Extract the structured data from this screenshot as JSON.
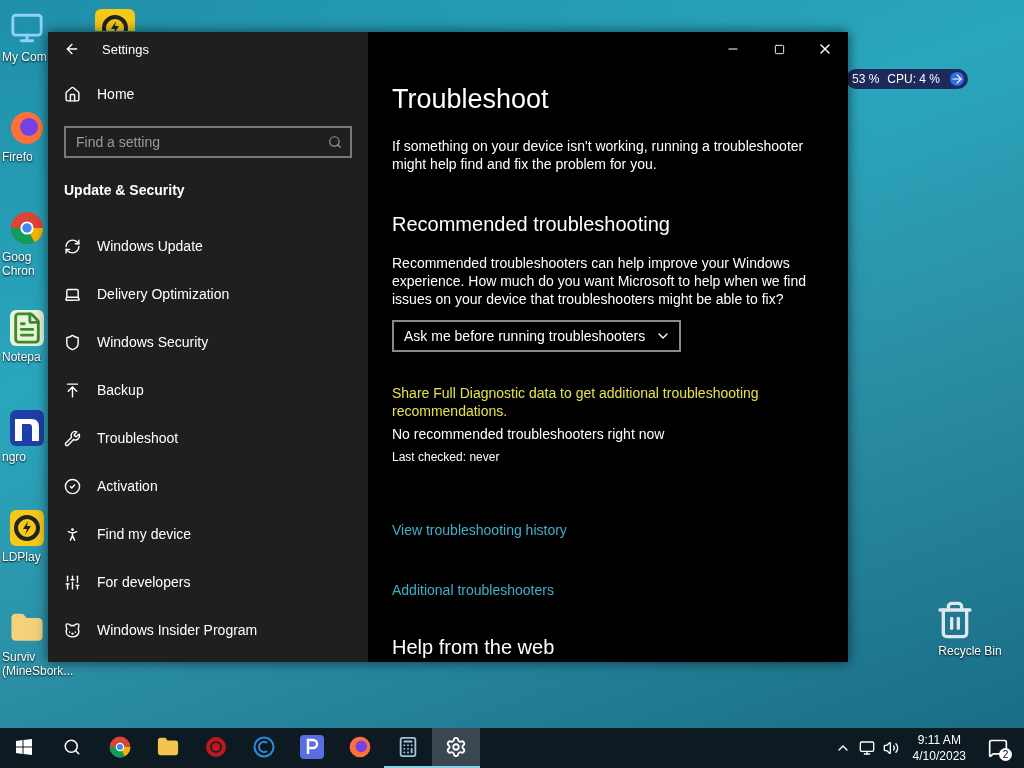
{
  "desktop_icons": [
    {
      "kind": "computer",
      "lines": [
        "My Com"
      ]
    },
    {
      "kind": "firefox",
      "lines": [
        "Firefo"
      ]
    },
    {
      "kind": "chrome",
      "lines": [
        "Goog",
        "Chron"
      ]
    },
    {
      "kind": "notepad",
      "lines": [
        "Notepa"
      ]
    },
    {
      "kind": "ngrok",
      "lines": [
        "ngro"
      ]
    },
    {
      "kind": "ldplayer",
      "lines": [
        "LDPlay"
      ]
    },
    {
      "kind": "folder",
      "lines": [
        "Surviv",
        "(MineSbork..."
      ]
    }
  ],
  "recycle_bin": {
    "label": "Recycle Bin"
  },
  "monitor_widget": {
    "memory": "53 %",
    "cpu": "CPU: 4 %"
  },
  "window": {
    "title": "Settings",
    "sidebar": {
      "home": "Home",
      "search": {
        "placeholder": "Find a setting"
      },
      "section": "Update & Security",
      "items": [
        {
          "kind": "update",
          "label": "Windows Update"
        },
        {
          "kind": "delivery",
          "label": "Delivery Optimization"
        },
        {
          "kind": "security",
          "label": "Windows Security"
        },
        {
          "kind": "backup",
          "label": "Backup"
        },
        {
          "kind": "troubleshoot",
          "label": "Troubleshoot"
        },
        {
          "kind": "activation",
          "label": "Activation"
        },
        {
          "kind": "find",
          "label": "Find my device"
        },
        {
          "kind": "developers",
          "label": "For developers"
        },
        {
          "kind": "insider",
          "label": "Windows Insider Program"
        }
      ]
    },
    "content": {
      "title": "Troubleshoot",
      "intro": "If something on your device isn't working, running a troubleshooter might help find and fix the problem for you.",
      "section": "Recommended troubleshooting",
      "description": "Recommended troubleshooters can help improve your Windows experience. How much do you want Microsoft to help when we find issues on your device that troubleshooters might be able to fix?",
      "dropdown": "Ask me before running troubleshooters",
      "diagnostic_link": "Share Full Diagnostic data to get additional troubleshooting recommendations.",
      "status": "No recommended troubleshooters right now",
      "last_checked": "Last checked: never",
      "links": [
        "View troubleshooting history",
        "Additional troubleshooters"
      ],
      "next_section": "Help from the web"
    }
  },
  "taskbar": {
    "apps": [
      {
        "kind": "chrome",
        "running": false,
        "active": false
      },
      {
        "kind": "explorer",
        "running": false,
        "active": false
      },
      {
        "kind": "red",
        "running": false,
        "active": false
      },
      {
        "kind": "ccleaner",
        "running": false,
        "active": false
      },
      {
        "kind": "p",
        "running": false,
        "active": false
      },
      {
        "kind": "firefox",
        "running": false,
        "active": false
      },
      {
        "kind": "calculator",
        "running": true,
        "active": false
      },
      {
        "kind": "settings",
        "running": true,
        "active": true
      }
    ],
    "time": "9:11 AM",
    "date": "4/10/2023",
    "notifications": "2"
  }
}
